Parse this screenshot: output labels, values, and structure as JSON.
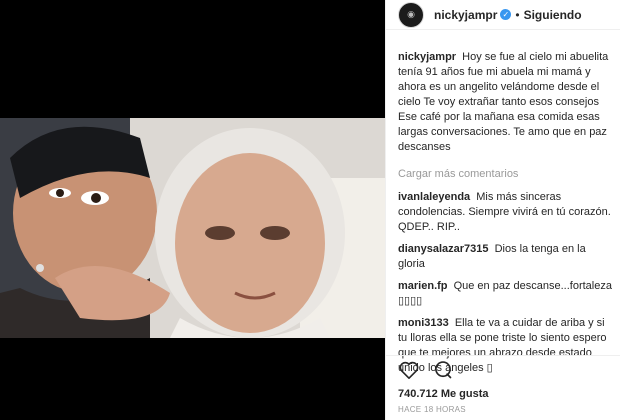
{
  "header": {
    "username": "nickyjampr",
    "verified_icon": "verified-badge-icon",
    "separator": "•",
    "follow_label": "Siguiendo"
  },
  "caption": {
    "username": "nickyjampr",
    "text": "Hoy se fue al cielo mi abuelita tenía 91 años fue mi abuela mi mamá y ahora es un angelito velándome desde el cielo Te voy extrañar tanto esos consejos Ese café por la mañana esa comida esas largas conversaciones. Te amo que en paz descanses"
  },
  "load_more": "Cargar más comentarios",
  "comments": [
    {
      "username": "ivanlaleyenda",
      "text": "Mis más sinceras condolencias. Siempre vivirá en tú corazón. QDEP.. RIP.."
    },
    {
      "username": "dianysalazar7315",
      "text": "Dios la tenga en la gloria"
    },
    {
      "username": "marien.fp",
      "text": "Que en paz descanse...fortaleza ▯▯▯▯"
    },
    {
      "username": "moni3133",
      "text": "Ella te va a cuidar de ariba y si tu lloras ella se pone triste lo siento espero que te mejores un abrazo desde estado unido los angeles ▯"
    }
  ],
  "actions": {
    "like_icon": "heart-icon",
    "comment_icon": "comment-bubble-icon"
  },
  "likes": "740.712 Me gusta",
  "timestamp": "HACE 18 HORAS",
  "colors": {
    "verified": "#3897f0",
    "border": "#efefef",
    "muted": "#999999",
    "text": "#262626",
    "letterbox": "#000000"
  }
}
